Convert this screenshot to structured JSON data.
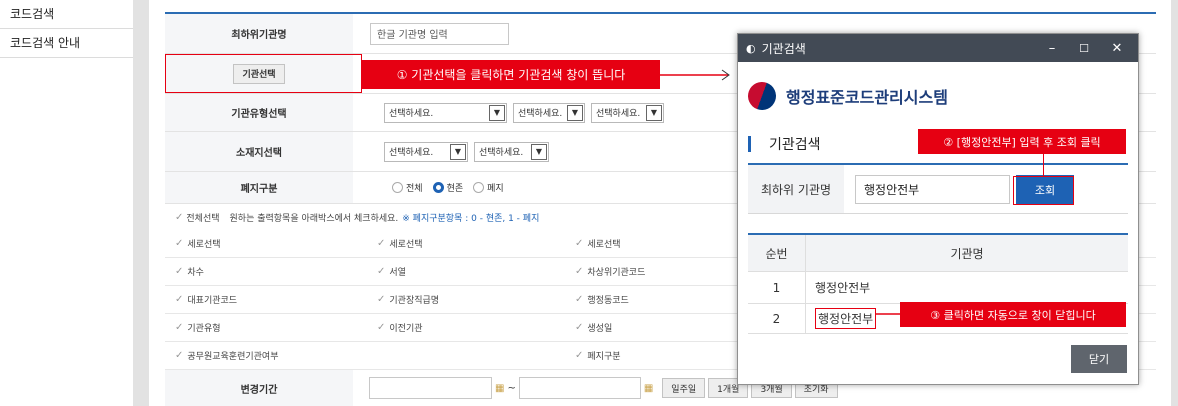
{
  "sidebar": {
    "items": [
      {
        "label": "코드검색"
      },
      {
        "label": "코드검색 안내"
      }
    ]
  },
  "form": {
    "lowest_org_name": {
      "label": "최하위기관명",
      "value": "한글 기관명 입력"
    },
    "org_select": {
      "button_label": "기관선택"
    },
    "org_type": {
      "label": "기관유형선택",
      "selects": [
        "선택하세요.",
        "선택하세요.",
        "선택하세요."
      ]
    },
    "location": {
      "label": "소재지선택",
      "selects": [
        "선택하세요.",
        "선택하세요."
      ]
    },
    "abolished": {
      "label": "폐지구분",
      "options": [
        {
          "label": "전체",
          "selected": false
        },
        {
          "label": "현존",
          "selected": true
        },
        {
          "label": "폐지",
          "selected": false
        }
      ]
    },
    "select_all": {
      "label": "전체선택",
      "instruction": "원하는 출력항목을 아래박스에서 체크하세요.",
      "note": "※ 폐지구분항목 : 0 - 현존, 1 - 폐지"
    },
    "checkbox_rows": [
      [
        "세로선택",
        "세로선택",
        "세로선택"
      ],
      [
        "차수",
        "서열",
        "차상위기관코드"
      ],
      [
        "대표기관코드",
        "기관장직급명",
        "행정동코드"
      ],
      [
        "기관유형",
        "이전기관",
        "생성일"
      ],
      [
        "공무원교육훈련기관여부",
        "",
        "폐지구분"
      ]
    ],
    "period": {
      "label": "변경기간",
      "tilde": "~",
      "buttons": [
        "일주일",
        "1개월",
        "3개월",
        "초기화"
      ]
    }
  },
  "annotations": {
    "step1": "① 기관선택을 클릭하면 기관검색 창이 뜹니다",
    "step2": "② [행정안전부] 입력 후 조회 클릭",
    "step3": "③ 클릭하면 자동으로 창이 닫힙니다"
  },
  "popup": {
    "title": "기관검색",
    "system_name": "행정표준코드관리시스템",
    "section_title": "기관검색",
    "search_label": "최하위 기관명",
    "search_value": "행정안전부",
    "search_button": "조회",
    "table": {
      "headers": [
        "순번",
        "기관명"
      ],
      "rows": [
        {
          "no": "1",
          "name": "행정안전부"
        },
        {
          "no": "2",
          "name": "행정안전부"
        }
      ]
    },
    "close_button": "닫기"
  },
  "colors": {
    "accent_blue": "#1e62b4",
    "annotation_red": "#e60012",
    "titlebar": "#424a55"
  }
}
